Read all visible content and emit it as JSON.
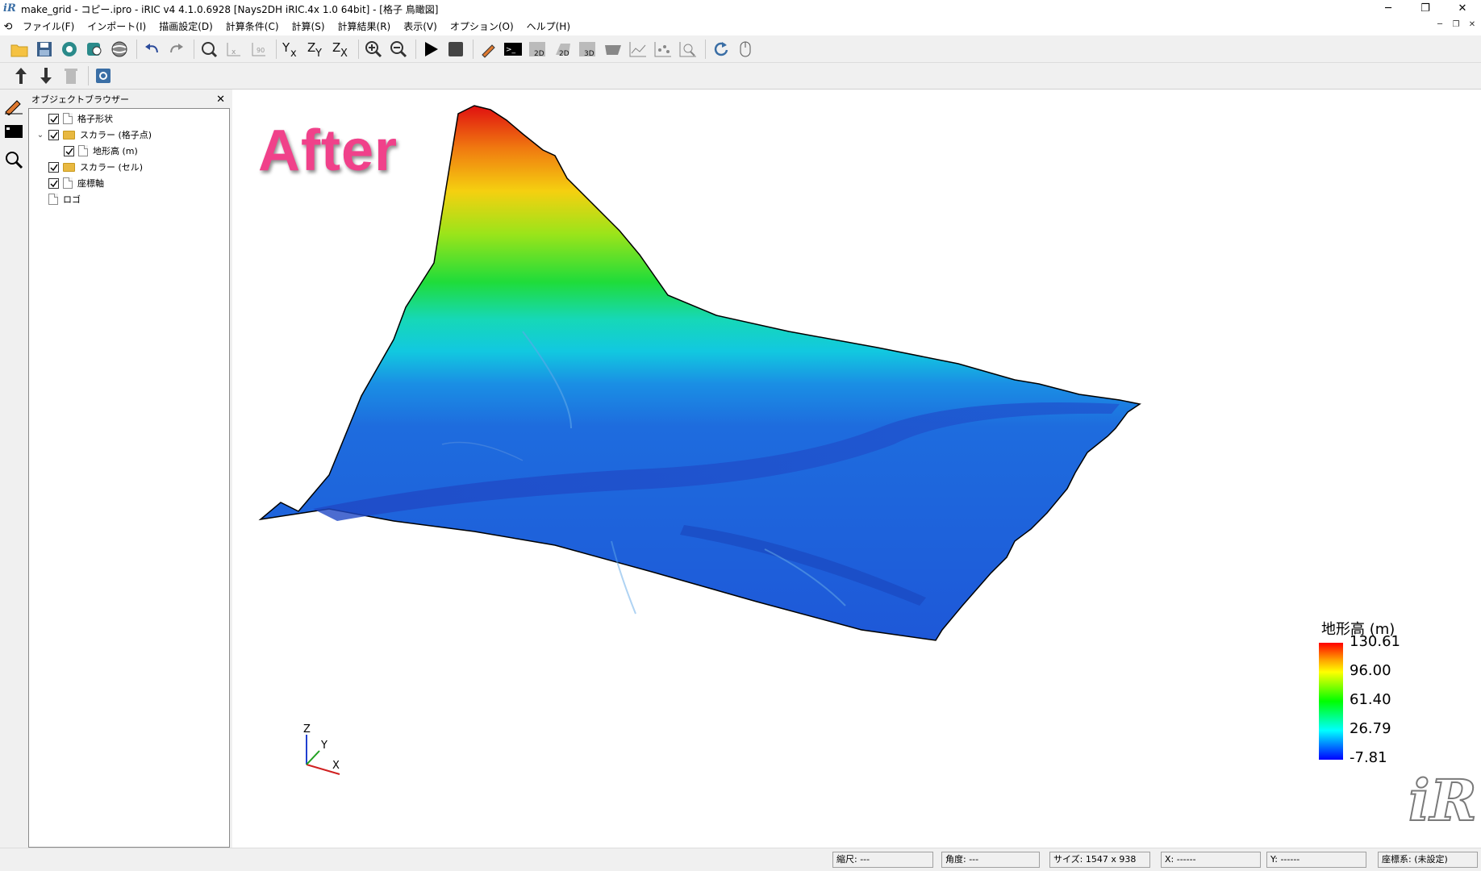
{
  "window": {
    "title": "make_grid - コピー.ipro - iRIC v4 4.1.0.6928 [Nays2DH iRIC.4x 1.0 64bit] - [格子 鳥瞰図]",
    "app_icon_text": "iR"
  },
  "menu": {
    "items": [
      "ファイル(F)",
      "インポート(I)",
      "描画設定(D)",
      "計算条件(C)",
      "計算(S)",
      "計算結果(R)",
      "表示(V)",
      "オプション(O)",
      "ヘルプ(H)"
    ]
  },
  "object_browser": {
    "title": "オブジェクトブラウザー",
    "items": [
      {
        "label": "格子形状",
        "checked": true,
        "icon": "document-icon"
      },
      {
        "label": "スカラー (格子点)",
        "checked": true,
        "icon": "folder-icon",
        "expanded": true
      },
      {
        "label": "地形高 (m)",
        "checked": true,
        "icon": "document-icon"
      },
      {
        "label": "スカラー (セル)",
        "checked": true,
        "icon": "folder-icon"
      },
      {
        "label": "座標軸",
        "checked": true,
        "icon": "document-icon"
      },
      {
        "label": "ロゴ",
        "checked": false,
        "icon": "document-icon"
      }
    ]
  },
  "viewport": {
    "overlay_label": "After",
    "axes": {
      "x": "X",
      "y": "Y",
      "z": "Z"
    },
    "legend": {
      "title": "地形高 (m)",
      "ticks": [
        "130.61",
        "96.00",
        "61.40",
        "26.79",
        "-7.81"
      ],
      "colors": [
        "#ff0000",
        "#ffff00",
        "#00ff00",
        "#00ffff",
        "#0000ff"
      ]
    },
    "logo_text": "iR"
  },
  "status": {
    "scale": "縮尺: ---",
    "angle": "角度: ---",
    "size": "サイズ: 1547 x 938",
    "x": "X: ------",
    "y": "Y: ------",
    "crs": "座標系: (未設定)"
  }
}
